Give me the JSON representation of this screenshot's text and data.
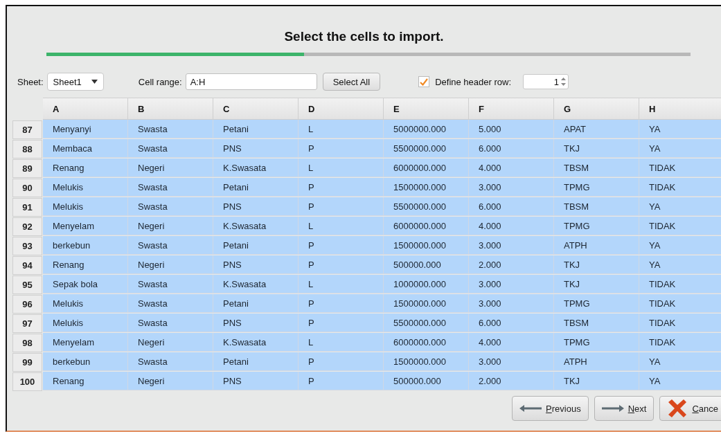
{
  "title": "Select the cells to import.",
  "progress": {
    "level": 0.4
  },
  "toolbar": {
    "sheet_label": "Sheet:",
    "sheet": "Sheet1",
    "range_label": "Cell range:",
    "range": "A:H",
    "select_all": "Select All",
    "header_row": {
      "label": "Define header row:",
      "checked": true,
      "value": "1"
    }
  },
  "table": {
    "columns": [
      "A",
      "B",
      "C",
      "D",
      "E",
      "F",
      "G",
      "H"
    ],
    "rows": [
      {
        "number": "87",
        "cells": [
          "Menyanyi",
          "Swasta",
          "Petani",
          "L",
          "5000000.000",
          "5.000",
          "APAT",
          "YA"
        ]
      },
      {
        "number": "88",
        "cells": [
          "Membaca",
          "Swasta",
          "PNS",
          "P",
          "5500000.000",
          "6.000",
          "TKJ",
          "YA"
        ]
      },
      {
        "number": "89",
        "cells": [
          "Renang",
          "Negeri",
          "K.Swasata",
          "L",
          "6000000.000",
          "4.000",
          "TBSM",
          "TIDAK"
        ]
      },
      {
        "number": "90",
        "cells": [
          "Melukis",
          "Swasta",
          "Petani",
          "P",
          "1500000.000",
          "3.000",
          "TPMG",
          "TIDAK"
        ]
      },
      {
        "number": "91",
        "cells": [
          "Melukis",
          "Swasta",
          "PNS",
          "P",
          "5500000.000",
          "6.000",
          "TBSM",
          "YA"
        ]
      },
      {
        "number": "92",
        "cells": [
          "Menyelam",
          "Negeri",
          "K.Swasata",
          "L",
          "6000000.000",
          "4.000",
          "TPMG",
          "TIDAK"
        ]
      },
      {
        "number": "93",
        "cells": [
          "berkebun",
          "Swasta",
          "Petani",
          "P",
          "1500000.000",
          "3.000",
          "ATPH",
          "YA"
        ]
      },
      {
        "number": "94",
        "cells": [
          "Renang",
          "Negeri",
          "PNS",
          "P",
          "500000.000",
          "2.000",
          "TKJ",
          "YA"
        ]
      },
      {
        "number": "95",
        "cells": [
          "Sepak bola",
          "Swasta",
          "K.Swasata",
          "L",
          "1000000.000",
          "3.000",
          "TKJ",
          "TIDAK"
        ]
      },
      {
        "number": "96",
        "cells": [
          "Melukis",
          "Swasta",
          "Petani",
          "P",
          "1500000.000",
          "3.000",
          "TPMG",
          "TIDAK"
        ]
      },
      {
        "number": "97",
        "cells": [
          "Melukis",
          "Swasta",
          "PNS",
          "P",
          "5500000.000",
          "6.000",
          "TBSM",
          "TIDAK"
        ]
      },
      {
        "number": "98",
        "cells": [
          "Menyelam",
          "Negeri",
          "K.Swasata",
          "L",
          "6000000.000",
          "4.000",
          "TPMG",
          "TIDAK"
        ]
      },
      {
        "number": "99",
        "cells": [
          "berkebun",
          "Swasta",
          "Petani",
          "P",
          "1500000.000",
          "3.000",
          "ATPH",
          "YA"
        ]
      },
      {
        "number": "100",
        "cells": [
          "Renang",
          "Negeri",
          "PNS",
          "P",
          "500000.000",
          "2.000",
          "TKJ",
          "YA"
        ]
      }
    ]
  },
  "buttons": [
    {
      "kind": "previous",
      "label": "Previous"
    },
    {
      "kind": "next",
      "label": "Next"
    },
    {
      "kind": "cancel",
      "label": "Cance"
    }
  ]
}
